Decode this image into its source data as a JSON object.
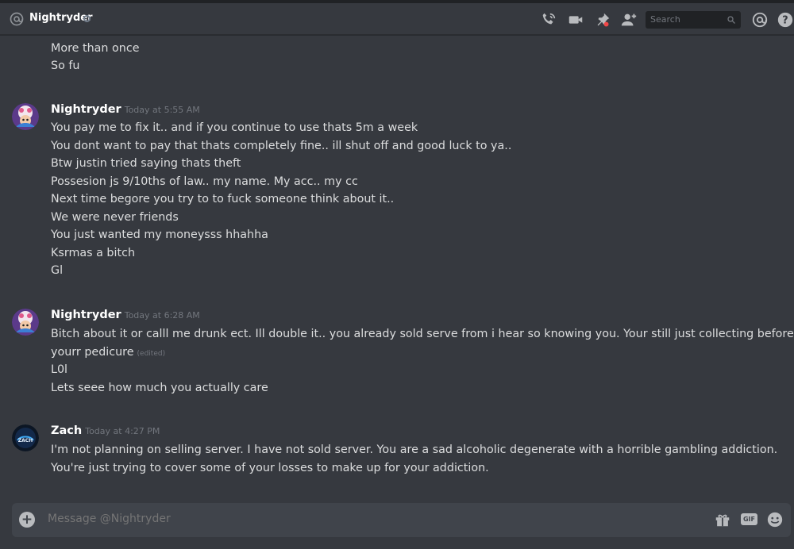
{
  "header": {
    "title": "Nightryder",
    "search_placeholder": "Search",
    "icons": [
      "at-icon",
      "phone-icon",
      "video-icon",
      "pin-icon",
      "add-friend-icon",
      "search-icon",
      "mention-icon",
      "help-icon"
    ]
  },
  "messages": {
    "partial_group": {
      "lines": [
        "More than once",
        "So fu"
      ]
    },
    "groups": [
      {
        "username": "Nightryder",
        "timestamp": "Today at 5:55 AM",
        "lines": [
          "You pay me to fix it.. and if you continue to use thats 5m a week",
          "You dont want to pay that thats completely fine.. ill shut off and good luck to ya..",
          "Btw justin tried saying thats theft",
          "Possesion js 9/10ths of law.. my name. My acc.. my cc",
          "Next time begore you try to to fuck someone think about it..",
          "We were never friends",
          "You just wanted my moneysss hhahha",
          "Ksrmas a bitch",
          "Gl"
        ]
      },
      {
        "username": "Nightryder",
        "timestamp": "Today at 6:28 AM",
        "lines": [
          "Bitch about it or calll me drunk ect. Ill double it..  you already sold serve from i hear so knowing you. Your still just collecting before",
          "yourr pedicure",
          "L0l",
          "Lets seee how much you actually care"
        ],
        "edited_label": "(edited)"
      },
      {
        "username": "Zach",
        "timestamp": "Today at 4:27 PM",
        "lines": [
          "I'm not planning on selling server.  I have not sold server.  You are a sad alcoholic degenerate with a horrible gambling addiction.",
          "You're just trying to cover some of your losses to make up for your addiction."
        ]
      }
    ]
  },
  "composer": {
    "placeholder": "Message @Nightryder",
    "gif_label": "GIF",
    "icons": [
      "add-attachment-icon",
      "gift-icon",
      "gif-icon",
      "emoji-icon"
    ]
  },
  "colors": {
    "background": "#36393f",
    "composer": "#40444b",
    "username": "#ffffff",
    "text": "#dcddde",
    "muted": "#72767d"
  }
}
